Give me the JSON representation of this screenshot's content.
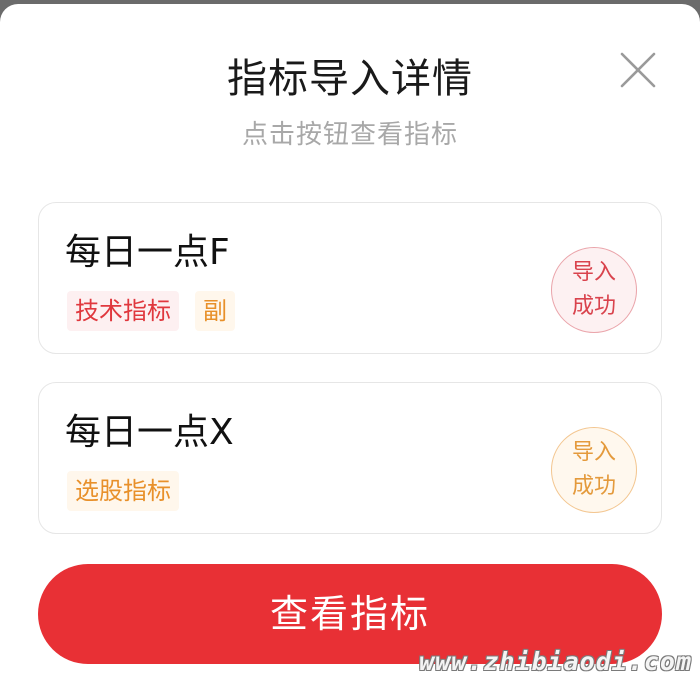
{
  "dialog": {
    "title": "指标导入详情",
    "subtitle": "点击按钮查看指标",
    "close_icon": "close-icon"
  },
  "indicators": [
    {
      "name": "每日一点F",
      "tags": [
        {
          "label": "技术指标",
          "color": "#e0383e"
        },
        {
          "label": "副",
          "color": "#e8902a"
        }
      ],
      "status": {
        "line1": "导入",
        "line2": "成功",
        "color": "#d9434d"
      }
    },
    {
      "name": "每日一点X",
      "tags": [
        {
          "label": "选股指标",
          "color": "#e8902a"
        }
      ],
      "status": {
        "line1": "导入",
        "line2": "成功",
        "color": "#e49a3c"
      }
    }
  ],
  "actions": {
    "view_label": "查看指标",
    "accent": "#e83035"
  },
  "watermark": "www.zhibiaodi.com"
}
